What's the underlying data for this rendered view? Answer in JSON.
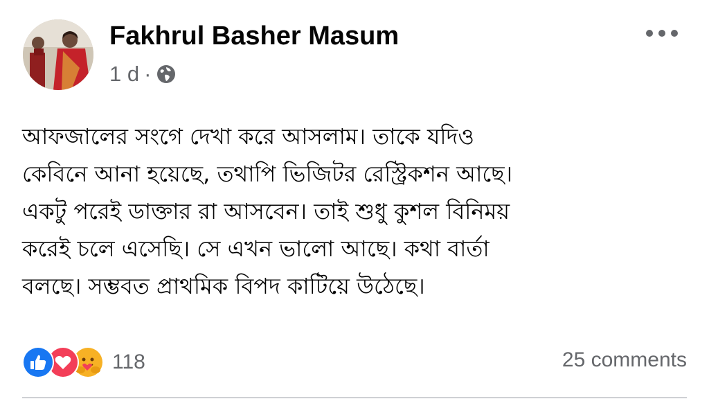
{
  "post": {
    "author": "Fakhrul Basher Masum",
    "time": "1 d",
    "separator": "·",
    "privacy_icon": "globe-icon",
    "more_icon": "more-options-icon",
    "body_lines": [
      "আফজালের সংগে দেখা করে আসলাম।  তাকে যদিও",
      "কেবিনে আনা হয়েছে, তথাপি ভিজিটর রেস্ট্রিকশন আছে।",
      "একটু পরেই ডাক্তার রা আসবেন।  তাই শুধু কুশল বিনিময়",
      "করেই চলে এসেছি।  সে এখন ভালো আছে। কথা বার্তা",
      "বলছে। সম্ভবত প্রাথমিক বিপদ কাটিয়ে উঠেছে।"
    ]
  },
  "reactions": {
    "icons": [
      "like-reaction-icon",
      "love-reaction-icon",
      "care-reaction-icon"
    ],
    "count": "118",
    "colors": {
      "like": "#1877f2",
      "love": "#f33e58",
      "care": "#f7b125"
    }
  },
  "comments": {
    "label": "25 comments"
  }
}
